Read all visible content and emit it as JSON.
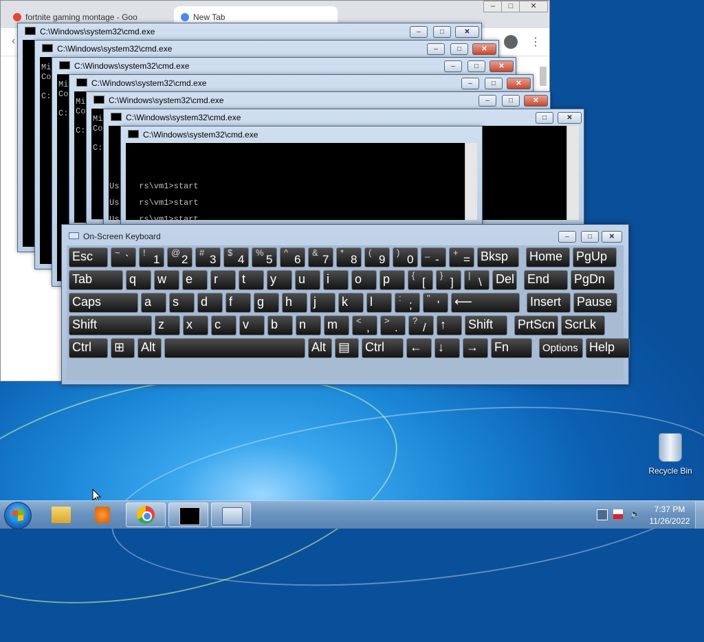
{
  "browser": {
    "tabs": [
      {
        "label": "fortnite gaming montage - Goo"
      },
      {
        "label": "New Tab"
      }
    ]
  },
  "cmd": {
    "title": "C:\\Windows\\system32\\cmd.exe",
    "fragments": [
      "Mi",
      "Co",
      "C:"
    ],
    "prompt_lines": [
      "Us    rs\\vm1>start",
      "Us    rs\\vm1>start",
      "Us    rs\\vm1>start"
    ]
  },
  "osk": {
    "title": "On-Screen Keyboard",
    "rows": [
      [
        {
          "id": "esc",
          "label": "Esc"
        },
        {
          "id": "tilde",
          "shift": "~",
          "main": "`"
        },
        {
          "id": "1",
          "shift": "!",
          "main": "1"
        },
        {
          "id": "2",
          "shift": "@",
          "main": "2"
        },
        {
          "id": "3",
          "shift": "#",
          "main": "3"
        },
        {
          "id": "4",
          "shift": "$",
          "main": "4"
        },
        {
          "id": "5",
          "shift": "%",
          "main": "5"
        },
        {
          "id": "6",
          "shift": "^",
          "main": "6"
        },
        {
          "id": "7",
          "shift": "&",
          "main": "7"
        },
        {
          "id": "8",
          "shift": "*",
          "main": "8"
        },
        {
          "id": "9",
          "shift": "(",
          "main": "9"
        },
        {
          "id": "0",
          "shift": ")",
          "main": "0"
        },
        {
          "id": "minus",
          "shift": "_",
          "main": "-"
        },
        {
          "id": "equals",
          "shift": "+",
          "main": "="
        },
        {
          "id": "bksp",
          "label": "Bksp"
        },
        {
          "id": "home",
          "label": "Home"
        },
        {
          "id": "pgup",
          "label": "PgUp"
        }
      ],
      [
        {
          "id": "tab",
          "label": "Tab"
        },
        {
          "id": "q",
          "label": "q"
        },
        {
          "id": "w",
          "label": "w"
        },
        {
          "id": "e",
          "label": "e"
        },
        {
          "id": "r",
          "label": "r"
        },
        {
          "id": "t",
          "label": "t"
        },
        {
          "id": "y",
          "label": "y"
        },
        {
          "id": "u",
          "label": "u"
        },
        {
          "id": "i",
          "label": "i"
        },
        {
          "id": "o",
          "label": "o"
        },
        {
          "id": "p",
          "label": "p"
        },
        {
          "id": "lbracket",
          "shift": "{",
          "main": "["
        },
        {
          "id": "rbracket",
          "shift": "}",
          "main": "]"
        },
        {
          "id": "backslash",
          "shift": "|",
          "main": "\\"
        },
        {
          "id": "del",
          "label": "Del"
        },
        {
          "id": "end",
          "label": "End"
        },
        {
          "id": "pgdn",
          "label": "PgDn"
        }
      ],
      [
        {
          "id": "caps",
          "label": "Caps"
        },
        {
          "id": "a",
          "label": "a"
        },
        {
          "id": "s",
          "label": "s"
        },
        {
          "id": "d",
          "label": "d"
        },
        {
          "id": "f",
          "label": "f"
        },
        {
          "id": "g",
          "label": "g"
        },
        {
          "id": "h",
          "label": "h"
        },
        {
          "id": "j",
          "label": "j"
        },
        {
          "id": "k",
          "label": "k"
        },
        {
          "id": "l",
          "label": "l"
        },
        {
          "id": "semicolon",
          "shift": ":",
          "main": ";"
        },
        {
          "id": "quote",
          "shift": "\"",
          "main": "'"
        },
        {
          "id": "enter",
          "label": "⟵"
        },
        {
          "id": "insert",
          "label": "Insert"
        },
        {
          "id": "pause",
          "label": "Pause"
        }
      ],
      [
        {
          "id": "lshift",
          "label": "Shift"
        },
        {
          "id": "z",
          "label": "z"
        },
        {
          "id": "x",
          "label": "x"
        },
        {
          "id": "c",
          "label": "c"
        },
        {
          "id": "v",
          "label": "v"
        },
        {
          "id": "b",
          "label": "b"
        },
        {
          "id": "n",
          "label": "n"
        },
        {
          "id": "m",
          "label": "m"
        },
        {
          "id": "comma",
          "shift": "<",
          "main": ","
        },
        {
          "id": "period",
          "shift": ">",
          "main": "."
        },
        {
          "id": "slash",
          "shift": "?",
          "main": "/"
        },
        {
          "id": "up",
          "label": "↑"
        },
        {
          "id": "rshift",
          "label": "Shift"
        },
        {
          "id": "prtscn",
          "label": "PrtScn"
        },
        {
          "id": "scrlk",
          "label": "ScrLk"
        }
      ],
      [
        {
          "id": "lctrl",
          "label": "Ctrl"
        },
        {
          "id": "win",
          "label": "⊞"
        },
        {
          "id": "lalt",
          "label": "Alt"
        },
        {
          "id": "space",
          "label": ""
        },
        {
          "id": "ralt",
          "label": "Alt"
        },
        {
          "id": "menu",
          "label": "▤"
        },
        {
          "id": "rctrl",
          "label": "Ctrl"
        },
        {
          "id": "left",
          "label": "←"
        },
        {
          "id": "down",
          "label": "↓"
        },
        {
          "id": "right",
          "label": "→"
        },
        {
          "id": "fn",
          "label": "Fn"
        },
        {
          "id": "options",
          "label": "Options"
        },
        {
          "id": "help",
          "label": "Help"
        }
      ]
    ]
  },
  "desktop": {
    "recycle_bin": "Recycle Bin"
  },
  "tray": {
    "time": "7:37 PM",
    "date": "11/26/2022"
  },
  "taskbar_icons": [
    "start-orb-icon",
    "file-explorer-icon",
    "media-player-icon",
    "chrome-icon",
    "cmd-icon",
    "on-screen-keyboard-icon"
  ],
  "colors": {
    "accent": "#1b86d6",
    "close_red": "#c94a32",
    "key_face": "#1f1f1f"
  }
}
